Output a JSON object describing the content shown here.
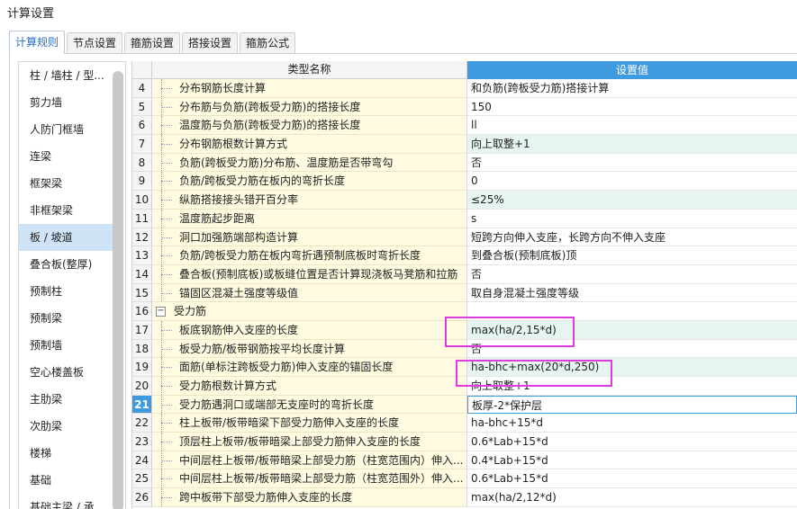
{
  "window": {
    "title": "计算设置"
  },
  "tabs": [
    {
      "label": "计算规则",
      "active": true
    },
    {
      "label": "节点设置",
      "active": false
    },
    {
      "label": "箍筋设置",
      "active": false
    },
    {
      "label": "搭接设置",
      "active": false
    },
    {
      "label": "箍筋公式",
      "active": false
    }
  ],
  "sidebar": {
    "items": [
      {
        "label": "柱 / 墙柱 / 型..."
      },
      {
        "label": "剪力墙"
      },
      {
        "label": "人防门框墙"
      },
      {
        "label": "连梁"
      },
      {
        "label": "框架梁"
      },
      {
        "label": "非框架梁"
      },
      {
        "label": "板 / 坡道",
        "active": true
      },
      {
        "label": "叠合板(整厚)"
      },
      {
        "label": "预制柱"
      },
      {
        "label": "预制梁"
      },
      {
        "label": "预制墙"
      },
      {
        "label": "空心楼盖板"
      },
      {
        "label": "主肋梁"
      },
      {
        "label": "次肋梁"
      },
      {
        "label": "楼梯"
      },
      {
        "label": "基础"
      },
      {
        "label": "基础主梁 / 承..."
      }
    ]
  },
  "grid": {
    "header": {
      "name": "类型名称",
      "value": "设置值"
    },
    "rows": [
      {
        "num": "4",
        "name": "分布钢筋长度计算",
        "value": "和负筋(跨板受力筋)搭接计算",
        "green": false
      },
      {
        "num": "5",
        "name": "分布筋与负筋(跨板受力筋)的搭接长度",
        "value": "150",
        "green": false
      },
      {
        "num": "6",
        "name": "温度筋与负筋(跨板受力筋)的搭接长度",
        "value": "ll",
        "green": false
      },
      {
        "num": "7",
        "name": "分布钢筋根数计算方式",
        "value": "向上取整+1",
        "green": true
      },
      {
        "num": "8",
        "name": "负筋(跨板受力筋)分布筋、温度筋是否带弯勾",
        "value": "否",
        "green": false
      },
      {
        "num": "9",
        "name": "负筋/跨板受力筋在板内的弯折长度",
        "value": "0",
        "green": false
      },
      {
        "num": "10",
        "name": "纵筋搭接接头错开百分率",
        "value": "≤25%",
        "green": true
      },
      {
        "num": "11",
        "name": "温度筋起步距离",
        "value": "s",
        "green": false
      },
      {
        "num": "12",
        "name": "洞口加强筋端部构造计算",
        "value": "短跨方向伸入支座，长跨方向不伸入支座",
        "green": false
      },
      {
        "num": "13",
        "name": "负筋/跨板受力筋在板内弯折遇预制底板时弯折长度",
        "value": "到叠合板(预制底板)顶",
        "green": false
      },
      {
        "num": "14",
        "name": "叠合板(预制底板)或板缝位置是否计算现浇板马凳筋和拉筋",
        "value": "否",
        "green": false
      },
      {
        "num": "15",
        "name": "锚固区混凝土强度等级值",
        "value": "取自身混凝土强度等级",
        "green": false
      },
      {
        "num": "16",
        "name": "受力筋",
        "value": "",
        "group": true,
        "expander": "−"
      },
      {
        "num": "17",
        "name": "板底钢筋伸入支座的长度",
        "value": "max(ha/2,15*d)",
        "green": true
      },
      {
        "num": "18",
        "name": "板受力筋/板带钢筋按平均长度计算",
        "value": "否",
        "green": false
      },
      {
        "num": "19",
        "name": "面筋(单标注跨板受力筋)伸入支座的锚固长度",
        "value": "ha-bhc+max(20*d,250)",
        "green": true
      },
      {
        "num": "20",
        "name": "受力筋根数计算方式",
        "value": "向上取整+1",
        "green": false
      },
      {
        "num": "21",
        "name": "受力筋遇洞口或端部无支座时的弯折长度",
        "value": "板厚-2*保护层",
        "selected": true
      },
      {
        "num": "22",
        "name": "柱上板带/板带暗梁下部受力筋伸入支座的长度",
        "value": "ha-bhc+15*d",
        "green": false
      },
      {
        "num": "23",
        "name": "顶层柱上板带/板带暗梁上部受力筋伸入支座的长度",
        "value": "0.6*Lab+15*d",
        "green": false
      },
      {
        "num": "24",
        "name": "中间层柱上板带/板带暗梁上部受力筋（柱宽范围内）伸入...",
        "value": "0.4*Lab+15*d",
        "green": false
      },
      {
        "num": "25",
        "name": "中间层柱上板带/板带暗梁上部受力筋（柱宽范围外）伸入...",
        "value": "0.6*Lab+15*d",
        "green": false
      },
      {
        "num": "26",
        "name": "跨中板带下部受力筋伸入支座的长度",
        "value": "max(ha/2,12*d)",
        "green": false
      }
    ]
  },
  "colors": {
    "accent": "#3f9be0",
    "highlight": "#e03be0",
    "name_bg": "#fffbe0",
    "green_bg": "#e6f6ee"
  }
}
